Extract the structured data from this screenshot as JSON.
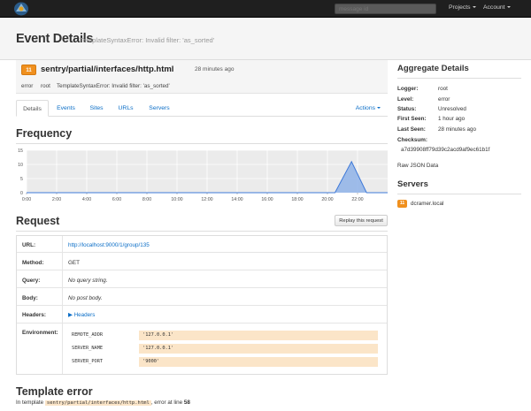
{
  "nav": {
    "search_placeholder": "message id",
    "projects_label": "Projects",
    "account_label": "Account"
  },
  "header": {
    "title": "Event Details",
    "subtitle": "TemplateSyntaxError: Invalid filter: 'as_sorted'"
  },
  "event": {
    "count": "11",
    "title": "sentry/partial/interfaces/http.html",
    "time": "28 minutes ago",
    "level": "error",
    "logger": "root",
    "message": "TemplateSyntaxError: Invalid filter: 'as_sorted'"
  },
  "tabs": [
    "Details",
    "Events",
    "Sites",
    "URLs",
    "Servers"
  ],
  "actions_label": "Actions",
  "frequency": {
    "heading": "Frequency"
  },
  "chart_data": {
    "type": "area",
    "x": [
      "0:00",
      "2:00",
      "4:00",
      "6:00",
      "8:00",
      "10:00",
      "12:00",
      "14:00",
      "16:00",
      "18:00",
      "20:00",
      "22:00"
    ],
    "y_ticks": [
      0,
      5,
      10,
      15
    ],
    "ylim": [
      0,
      15
    ],
    "series": [
      {
        "points": [
          {
            "hour": 0,
            "value": 0
          },
          {
            "hour": 20.5,
            "value": 0
          },
          {
            "hour": 21.6,
            "value": 11
          },
          {
            "hour": 22.6,
            "value": 0
          },
          {
            "hour": 24,
            "value": 0
          }
        ]
      }
    ],
    "grid": true,
    "colors": {
      "fill": "#8fb3e8",
      "stroke": "#3d78d8",
      "plot_bg": "#ebebeb"
    }
  },
  "request": {
    "heading": "Request",
    "replay_label": "Replay this request",
    "rows": {
      "url": {
        "label": "URL:",
        "value": "http://localhost:9000/1/group/135"
      },
      "method": {
        "label": "Method:",
        "value": "GET"
      },
      "query": {
        "label": "Query:",
        "value": "No query string."
      },
      "body": {
        "label": "Body:",
        "value": "No post body."
      },
      "headers": {
        "label": "Headers:",
        "value": "Headers"
      },
      "environment": {
        "label": "Environment:"
      }
    },
    "environment": [
      {
        "key": "REMOTE_ADDR",
        "value": "'127.0.0.1'"
      },
      {
        "key": "SERVER_NAME",
        "value": "'127.0.0.1'"
      },
      {
        "key": "SERVER_PORT",
        "value": "'9000'"
      }
    ]
  },
  "template_error": {
    "heading": "Template error",
    "prefix": "In template",
    "file": "sentry/partial/interfaces/http.html",
    "middle": ", error at line",
    "line": "58"
  },
  "aggregate": {
    "heading": "Aggregate Details",
    "logger_label": "Logger:",
    "logger_value": "root",
    "level_label": "Level:",
    "level_value": "error",
    "status_label": "Status:",
    "status_value": "Unresolved",
    "first_seen_label": "First Seen:",
    "first_seen_value": "1 hour ago",
    "last_seen_label": "Last Seen:",
    "last_seen_value": "28 minutes ago",
    "checksum_label": "Checksum:",
    "checksum_value": "a7d39908ff79d39c2acd9af9ec61b1f",
    "raw_json_label": "Raw JSON Data"
  },
  "servers": {
    "heading": "Servers",
    "items": [
      {
        "count": "11",
        "name": "dcramer.local"
      }
    ]
  }
}
